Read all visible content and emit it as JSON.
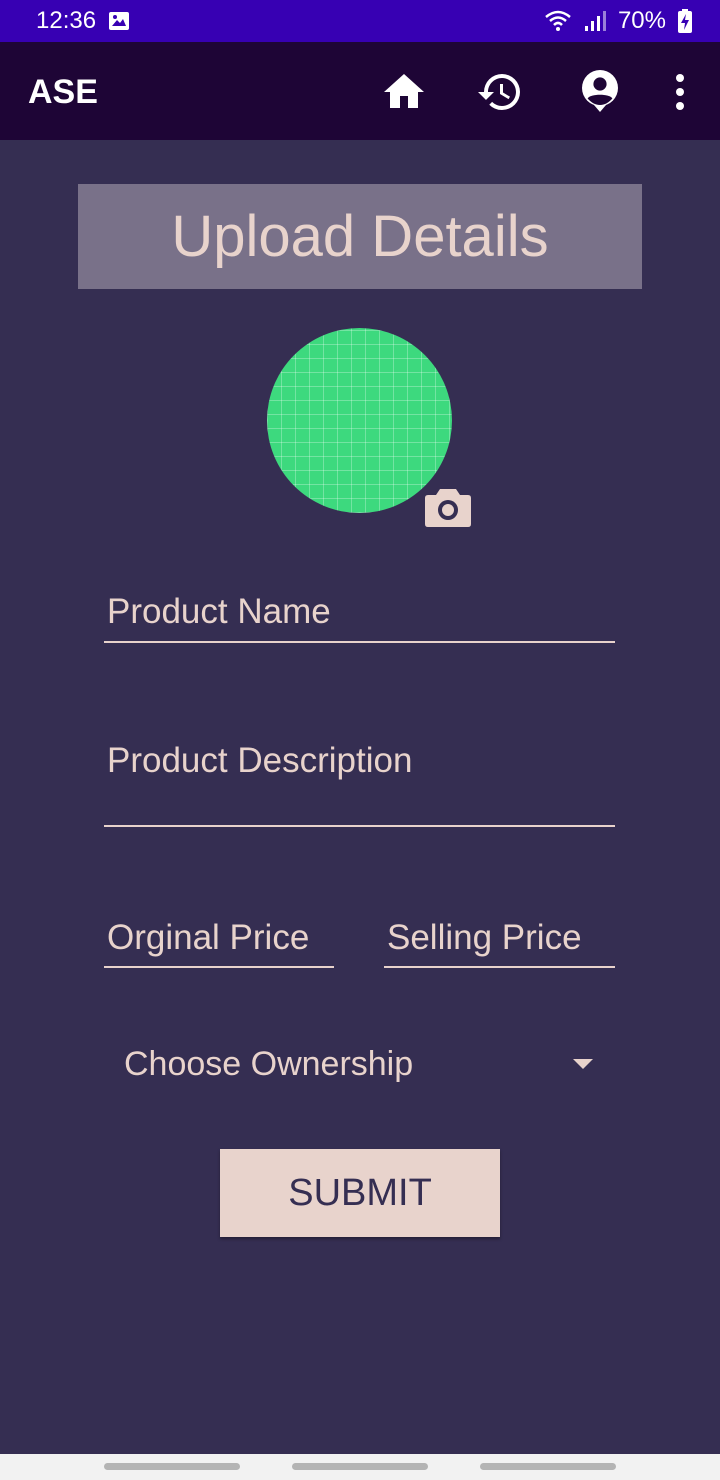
{
  "status_bar": {
    "time": "12:36",
    "battery": "70%",
    "icons": [
      "image-icon",
      "wifi-icon",
      "signal-icon",
      "battery-charging-icon"
    ]
  },
  "app_bar": {
    "title": "ASE",
    "actions": [
      "home-icon",
      "history-icon",
      "account-icon",
      "more-vert-icon"
    ]
  },
  "page": {
    "heading": "Upload Details"
  },
  "form": {
    "product_name_placeholder": "Product Name",
    "product_description_placeholder": "Product Description",
    "original_price_placeholder": "Orginal Price",
    "selling_price_placeholder": "Selling Price",
    "ownership_selected": "Choose Ownership",
    "submit_label": "SUBMIT"
  },
  "colors": {
    "status_bar": "#3700b3",
    "app_bar": "#1e0536",
    "background": "#352e52",
    "banner": "#797189",
    "accent_text": "#e8d3cc",
    "avatar": "#3dd97e"
  }
}
